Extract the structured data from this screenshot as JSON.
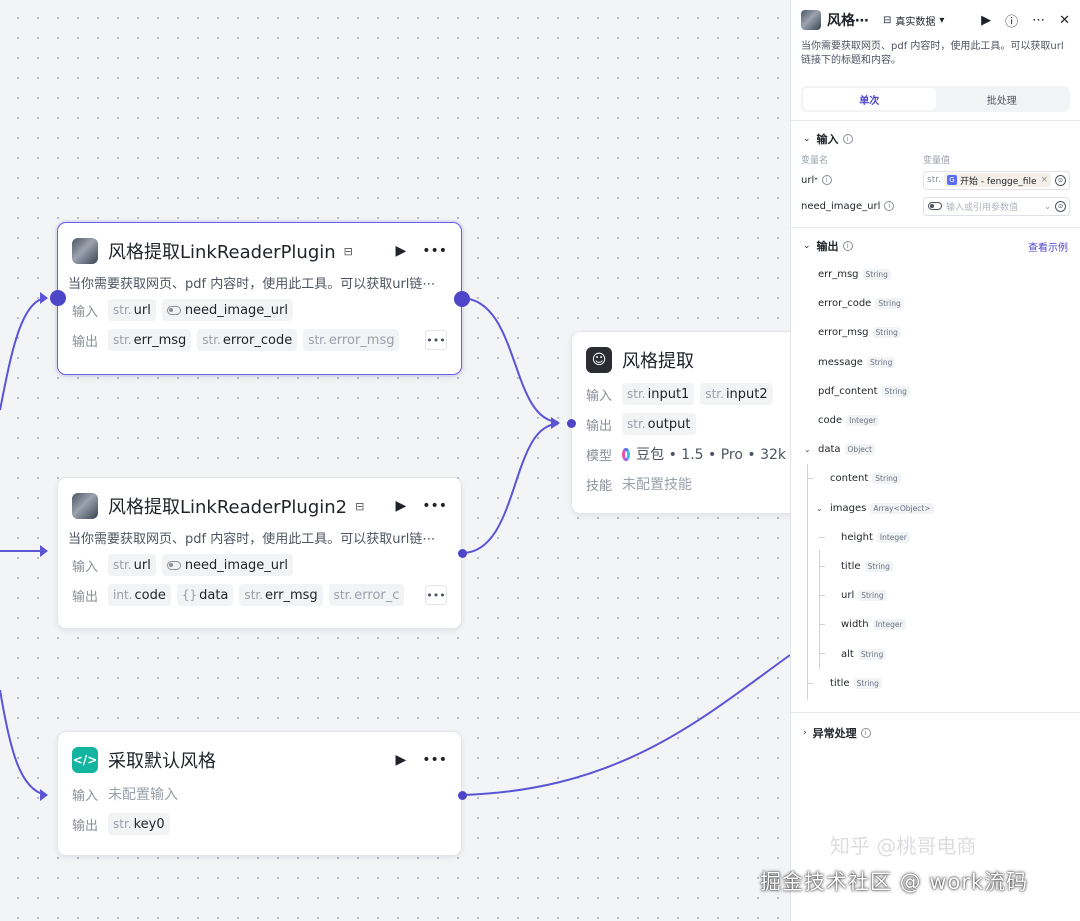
{
  "nodes": {
    "plugin1": {
      "title": "风格提取LinkReaderPlugin",
      "desc": "当你需要获取网页、pdf 内容时，使用此工具。可以获取url链⋯",
      "input_label": "输入",
      "output_label": "输出",
      "inputs": [
        {
          "type": "str.",
          "name": "url"
        },
        {
          "type": "toggle",
          "name": "need_image_url"
        }
      ],
      "outputs": [
        {
          "type": "str.",
          "name": "err_msg"
        },
        {
          "type": "str.",
          "name": "error_code"
        },
        {
          "type": "str.",
          "name": "error_msg"
        }
      ]
    },
    "plugin2": {
      "title": "风格提取LinkReaderPlugin2",
      "desc": "当你需要获取网页、pdf 内容时，使用此工具。可以获取url链⋯",
      "input_label": "输入",
      "output_label": "输出",
      "inputs": [
        {
          "type": "str.",
          "name": "url"
        },
        {
          "type": "toggle",
          "name": "need_image_url"
        }
      ],
      "outputs": [
        {
          "type": "int.",
          "name": "code"
        },
        {
          "type": "{}",
          "name": "data"
        },
        {
          "type": "str.",
          "name": "err_msg"
        },
        {
          "type": "str.",
          "name": "error_c"
        }
      ]
    },
    "llm": {
      "title": "风格提取",
      "input_label": "输入",
      "output_label": "输出",
      "model_label": "模型",
      "skill_label": "技能",
      "inputs": [
        {
          "type": "str.",
          "name": "input1"
        },
        {
          "type": "str.",
          "name": "input2"
        }
      ],
      "outputs": [
        {
          "type": "str.",
          "name": "output"
        }
      ],
      "model": "豆包 • 1.5 • Pro • 32k",
      "skills": "未配置技能"
    },
    "code": {
      "title": "采取默认风格",
      "input_label": "输入",
      "output_label": "输出",
      "inputs_empty": "未配置输入",
      "outputs": [
        {
          "type": "str.",
          "name": "key0"
        }
      ]
    }
  },
  "panel": {
    "title": "风格⋯",
    "mode": "真实数据",
    "desc": "当你需要获取网页、pdf 内容时，使用此工具。可以获取url链接下的标题和内容。",
    "tabs": [
      "单次",
      "批处理"
    ],
    "active_tab": 0,
    "input_section": "输入",
    "col_name": "变量名",
    "col_value": "变量值",
    "inputs": [
      {
        "name": "url",
        "required": "*",
        "type": "str.",
        "ref": "开始 - fengge_file"
      },
      {
        "name": "need_image_url",
        "placeholder": "输入或引用参数值"
      }
    ],
    "output_section": "输出",
    "output_link": "查看示例",
    "outputs": [
      {
        "name": "err_msg",
        "type": "String",
        "level": 0
      },
      {
        "name": "error_code",
        "type": "String",
        "level": 0
      },
      {
        "name": "error_msg",
        "type": "String",
        "level": 0
      },
      {
        "name": "message",
        "type": "String",
        "level": 0
      },
      {
        "name": "pdf_content",
        "type": "String",
        "level": 0
      },
      {
        "name": "code",
        "type": "Integer",
        "level": 0
      },
      {
        "name": "data",
        "type": "Object",
        "level": 0,
        "expanded": true
      },
      {
        "name": "content",
        "type": "String",
        "level": 1
      },
      {
        "name": "images",
        "type": "Array<Object>",
        "level": 1,
        "expanded": true
      },
      {
        "name": "height",
        "type": "Integer",
        "level": 2
      },
      {
        "name": "title",
        "type": "String",
        "level": 2
      },
      {
        "name": "url",
        "type": "String",
        "level": 2
      },
      {
        "name": "width",
        "type": "Integer",
        "level": 2
      },
      {
        "name": "alt",
        "type": "String",
        "level": 2
      },
      {
        "name": "title",
        "type": "String",
        "level": 1
      }
    ],
    "error_section": "异常处理"
  },
  "watermark": "掘金技术社区 @ work流码",
  "watermark_ghost": "知乎 @桃哥电商",
  "colors": {
    "accent": "#4e46c8",
    "edge": "#5b55d6",
    "code_icon": "#13b5a1"
  }
}
